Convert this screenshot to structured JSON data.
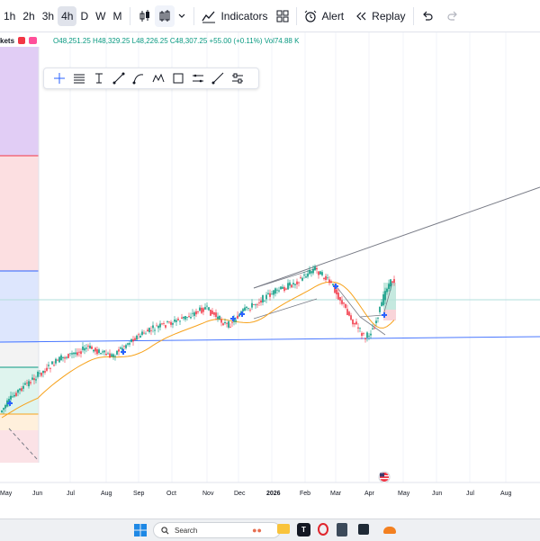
{
  "toolbar": {
    "timeframes": [
      "1h",
      "2h",
      "3h",
      "4h",
      "D",
      "W",
      "M"
    ],
    "active_timeframe": "4h",
    "indicators_label": "Indicators",
    "alert_label": "Alert",
    "replay_label": "Replay"
  },
  "legend": {
    "symbol_fragment": "kets",
    "ohlc": "O48,251.25 H48,329.25 L48,226.25 C48,307.25 +55.00 (+0.11%) Vol74.88 K",
    "accent_colors": [
      "#f23645",
      "#ff4f9a"
    ]
  },
  "drawing_tools": [
    "crosshair-icon",
    "horizontal-lines-icon",
    "text-cursor-icon",
    "trend-line-icon",
    "curve-icon",
    "pattern-icon",
    "rectangle-icon",
    "parallel-channel-icon",
    "ray-icon",
    "settings-sliders-icon"
  ],
  "x_axis": {
    "labels": [
      "May",
      "Jun",
      "Jul",
      "Aug",
      "Sep",
      "Oct",
      "Nov",
      "Dec",
      "2026",
      "Feb",
      "Mar",
      "Apr",
      "May",
      "Jun",
      "Jul",
      "Aug"
    ]
  },
  "taskbar": {
    "search_placeholder": "Search"
  },
  "colors": {
    "accent_blue": "#2962ff",
    "up": "#089981",
    "down": "#f23645",
    "ma_line": "#f7a21b"
  }
}
